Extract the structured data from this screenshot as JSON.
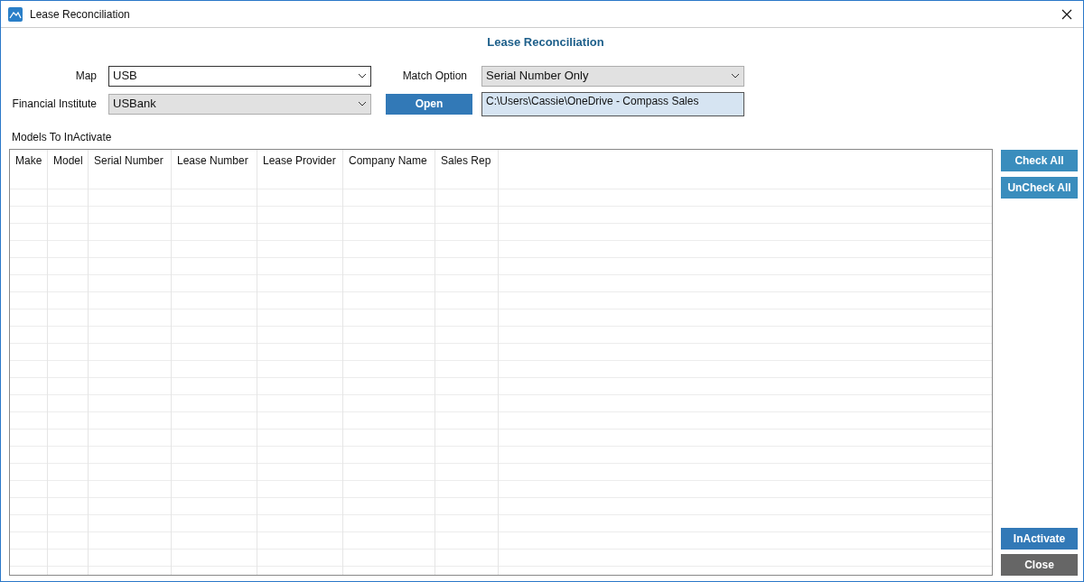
{
  "window": {
    "title": "Lease Reconciliation"
  },
  "heading": "Lease Reconciliation",
  "map": {
    "label": "Map",
    "value": "USB",
    "disabled": false
  },
  "financial_institute": {
    "label": "Financial Institute",
    "value": "USBank",
    "disabled": true
  },
  "match_option": {
    "label": "Match Option",
    "value": "Serial Number Only",
    "disabled": true
  },
  "open_button": "Open",
  "file_path": "C:\\Users\\Cassie\\OneDrive - Compass Sales",
  "table": {
    "title": "Models To InActivate",
    "columns": [
      "Make",
      "Model",
      "Serial Number",
      "Lease Number",
      "Lease Provider",
      "Company Name",
      "Sales Rep"
    ]
  },
  "side_buttons": [
    {
      "label": "Check All",
      "kind": "light"
    },
    {
      "label": "UnCheck All",
      "kind": "light"
    }
  ],
  "bottom_buttons": [
    {
      "label": "InActivate",
      "kind": "primary"
    },
    {
      "label": "Close",
      "kind": "dark"
    }
  ]
}
